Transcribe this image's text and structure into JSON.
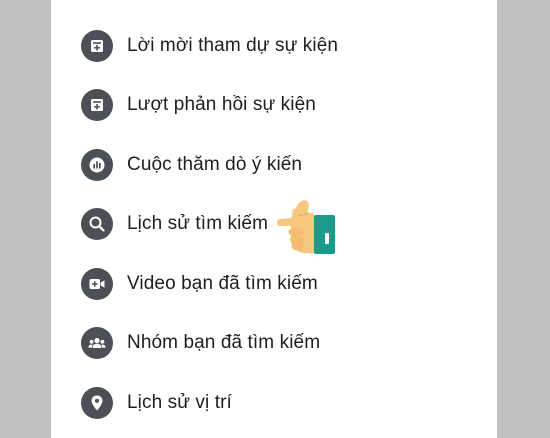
{
  "menu": {
    "items": [
      {
        "label": "Lời mời tham dự sự kiện",
        "icon": "event-invite-icon"
      },
      {
        "label": "Lượt phản hồi sự kiện",
        "icon": "event-response-icon"
      },
      {
        "label": "Cuộc thăm dò ý kiến",
        "icon": "poll-icon"
      },
      {
        "label": "Lịch sử tìm kiếm",
        "icon": "search-icon"
      },
      {
        "label": "Video bạn đã tìm kiếm",
        "icon": "video-camera-icon"
      },
      {
        "label": "Nhóm bạn đã tìm kiếm",
        "icon": "group-icon"
      },
      {
        "label": "Lịch sử vị trí",
        "icon": "location-pin-icon"
      }
    ]
  },
  "colors": {
    "background": "#c0bfc2",
    "panel": "#ffffff",
    "icon_circle": "#4b4f56",
    "text": "#1c1e21",
    "pointer_skin": "#f6c77f",
    "pointer_cuff": "#1c9b8a"
  }
}
